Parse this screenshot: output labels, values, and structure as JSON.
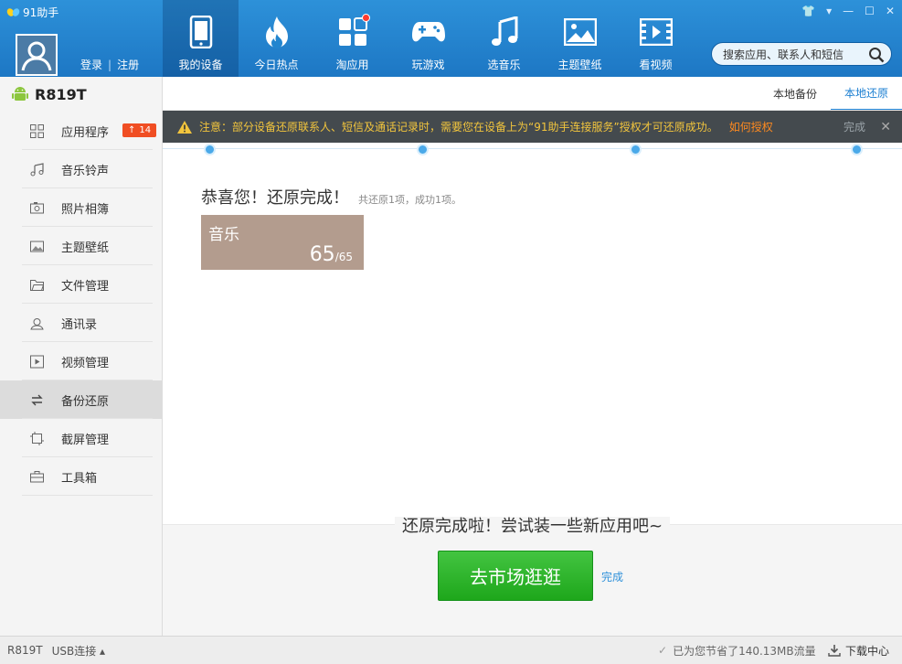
{
  "app": {
    "title": "91助手"
  },
  "user": {
    "login": "登录",
    "register": "注册"
  },
  "nav": [
    {
      "label": "我的设备",
      "icon": "phone-icon"
    },
    {
      "label": "今日热点",
      "icon": "flame-icon"
    },
    {
      "label": "淘应用",
      "icon": "apps-icon"
    },
    {
      "label": "玩游戏",
      "icon": "gamepad-icon"
    },
    {
      "label": "选音乐",
      "icon": "music-note-icon"
    },
    {
      "label": "主题壁纸",
      "icon": "picture-icon"
    },
    {
      "label": "看视频",
      "icon": "film-icon"
    }
  ],
  "search": {
    "placeholder": "搜索应用、联系人和短信"
  },
  "device": {
    "name": "R819T"
  },
  "sidebar": {
    "items": [
      {
        "label": "应用程序",
        "icon": "grid-icon",
        "badge": "14"
      },
      {
        "label": "音乐铃声",
        "icon": "music-icon"
      },
      {
        "label": "照片相簿",
        "icon": "camera-icon"
      },
      {
        "label": "主题壁纸",
        "icon": "image-icon"
      },
      {
        "label": "文件管理",
        "icon": "folder-icon"
      },
      {
        "label": "通讯录",
        "icon": "contact-icon"
      },
      {
        "label": "视频管理",
        "icon": "video-icon"
      },
      {
        "label": "备份还原",
        "icon": "sync-icon"
      },
      {
        "label": "截屏管理",
        "icon": "screenshot-icon"
      },
      {
        "label": "工具箱",
        "icon": "toolbox-icon"
      }
    ]
  },
  "tabs": {
    "backup": "本地备份",
    "restore": "本地还原"
  },
  "notice": {
    "text": "注意：部分设备还原联系人、短信及通话记录时，需要您在设备上为“91助手连接服务”授权才可还原成功。",
    "link": "如何授权",
    "done": "完成"
  },
  "result": {
    "title": "恭喜您！还原完成！",
    "summary": "共还原1项，成功1项。"
  },
  "card": {
    "name": "音乐",
    "count": "65",
    "total": "/65"
  },
  "bottom": {
    "title": "还原完成啦！尝试装一些新应用吧~",
    "button": "去市场逛逛",
    "done": "完成"
  },
  "status": {
    "device": "R819T",
    "connection": "USB连接 ▴",
    "saved": "已为您节省了140.13MB流量",
    "download": "下载中心"
  },
  "colors": {
    "header": "#2285cf",
    "notice_bg": "#444a4e",
    "notice_text": "#f2c53d",
    "green_button": "#2eb32c",
    "card": "#b39c8e"
  }
}
